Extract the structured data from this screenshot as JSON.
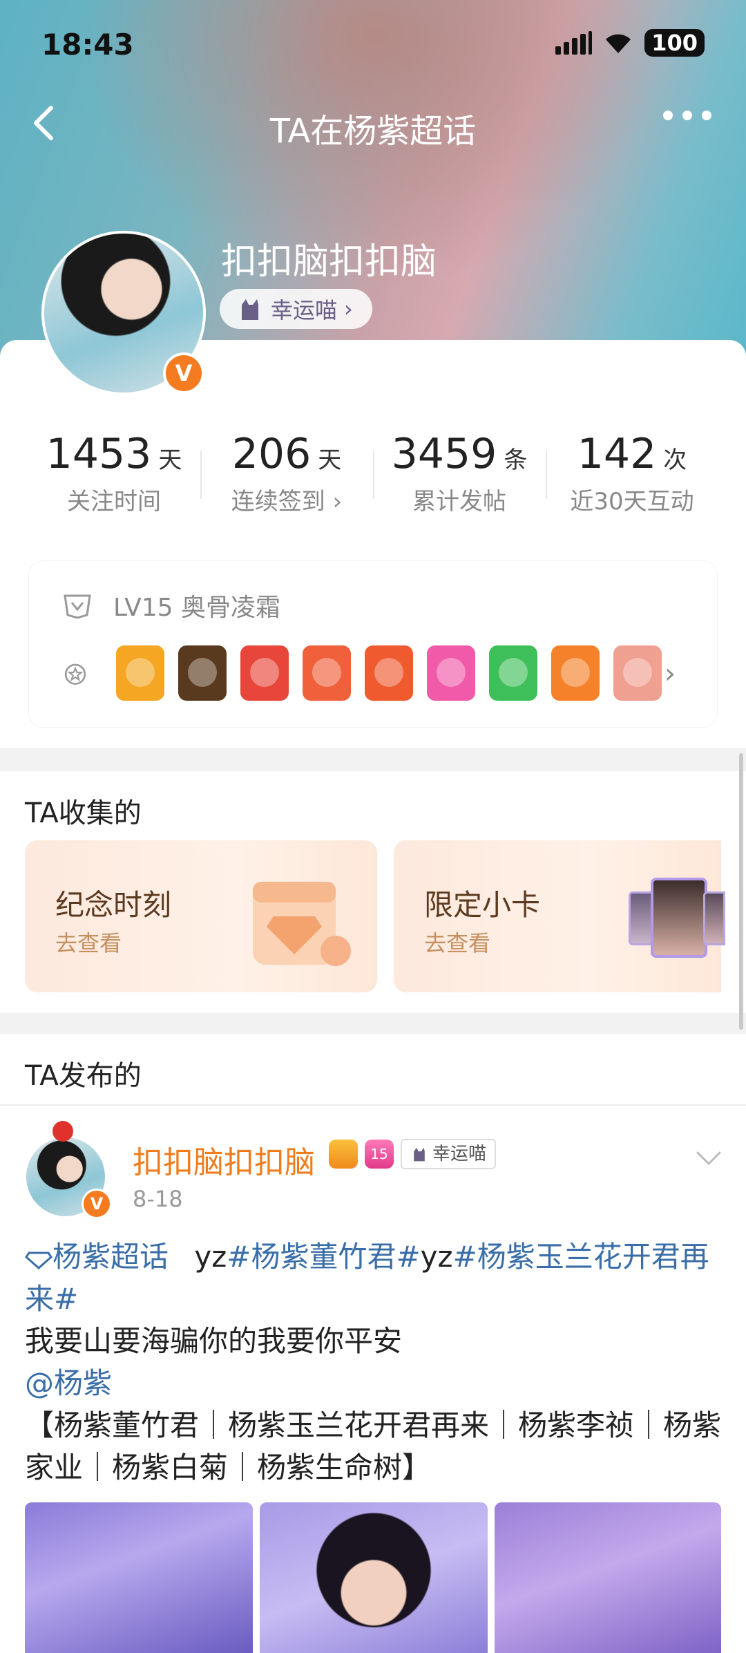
{
  "status_bar": {
    "time": "18:43",
    "battery": "100"
  },
  "nav": {
    "title": "TA在杨紫超话"
  },
  "profile": {
    "username": "扣扣脑扣扣脑",
    "tag": "幸运喵",
    "verified_mark": "V"
  },
  "stats": [
    {
      "value": "1453",
      "unit": "天",
      "label": "关注时间"
    },
    {
      "value": "206",
      "unit": "天",
      "label": "连续签到 ›"
    },
    {
      "value": "3459",
      "unit": "条",
      "label": "累计发帖"
    },
    {
      "value": "142",
      "unit": "次",
      "label": "近30天互动"
    }
  ],
  "level": {
    "text": "LV15 奥骨凌霜"
  },
  "badges": [
    {
      "name": "orange-wing-badge",
      "color": "#f5a623"
    },
    {
      "name": "super-crown-badge",
      "color": "#5a3a1e"
    },
    {
      "name": "cat-red-badge",
      "color": "#e8463a"
    },
    {
      "name": "cat-orange-badge",
      "color": "#f0603a"
    },
    {
      "name": "cat-crown-badge",
      "color": "#ef5a2e"
    },
    {
      "name": "lv15-pink-badge",
      "color": "#f05aa8"
    },
    {
      "name": "green-hand-badge",
      "color": "#3fbf5a"
    },
    {
      "name": "100-days-badge",
      "color": "#f5822a"
    },
    {
      "name": "partial-badge",
      "color": "#f0a090"
    }
  ],
  "collections": {
    "title": "TA收集的",
    "items": [
      {
        "title": "纪念时刻",
        "subtitle": "去查看"
      },
      {
        "title": "限定小卡",
        "subtitle": "去查看"
      }
    ]
  },
  "posts_section": {
    "title": "TA发布的"
  },
  "post": {
    "author": "扣扣脑扣扣脑",
    "date": "8-18",
    "level_badge": "15",
    "tag": "幸运喵",
    "verified_mark": "V",
    "topic": "杨紫超话",
    "line1_plain": "yz",
    "hashtag1": "#杨紫董竹君#",
    "line1_plain2": "yz",
    "hashtag2": "#杨紫玉兰花开君再来#",
    "line2": "我要山要海骗你的我要你平安",
    "mention": "@杨紫",
    "line3": "【杨紫董竹君｜杨紫玉兰花开君再来｜杨紫李祯｜杨紫家业｜杨紫白菊｜杨紫生命树】"
  }
}
